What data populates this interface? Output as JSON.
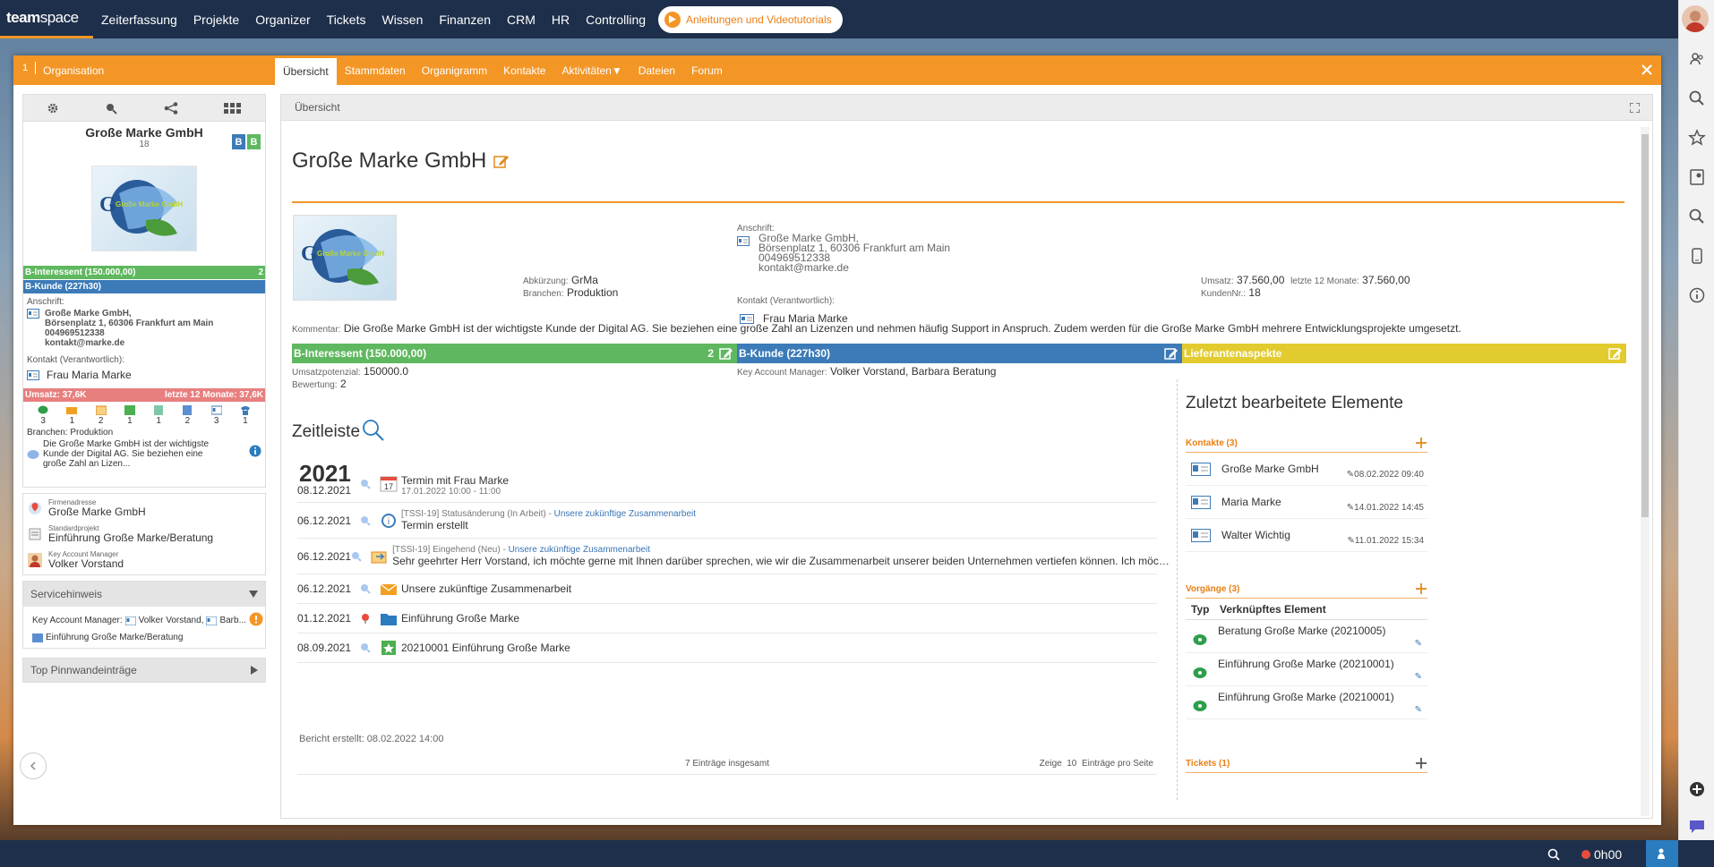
{
  "topnav": {
    "logo_bold": "team",
    "logo_light": "space",
    "items": [
      "Zeiterfassung",
      "Projekte",
      "Organizer",
      "Tickets",
      "Wissen",
      "Finanzen",
      "CRM",
      "HR",
      "Controlling"
    ],
    "tutorial_label": "Anleitungen und Videotutorials"
  },
  "window": {
    "number": "1",
    "title": "Organisation",
    "tabs": [
      "Übersicht",
      "Stammdaten",
      "Organigramm",
      "Kontakte",
      "Aktivitäten▼",
      "Dateien",
      "Forum"
    ]
  },
  "left": {
    "name": "Große Marke GmbH",
    "number": "18",
    "badges": [
      "B",
      "B"
    ],
    "logo_text": "Große Marke GmbH",
    "bar_green": "B-Interessent (150.000,00)",
    "bar_green_count": "2",
    "bar_blue": "B-Kunde (227h30)",
    "addr_label": "Anschrift:",
    "addr_lines": [
      "Große Marke GmbH,",
      "Börsenplatz 1, 60306 Frankfurt am Main",
      "004969512338",
      "kontakt@marke.de"
    ],
    "contact_label": "Kontakt (Verantwortlich):",
    "contact_name": "Frau Maria Marke",
    "umsatz_left": "Umsatz: 37,6K",
    "umsatz_right": "letzte 12 Monate: 37,6K",
    "counts": [
      "3",
      "1",
      "2",
      "1",
      "1",
      "2",
      "3",
      "1"
    ],
    "branchen": "Branchen: Produktion",
    "comment": "Die Große Marke GmbH ist der wichtigste Kunde der Digital AG. Sie beziehen eine große Zahl an Lizen...",
    "firmenadresse_label": "Firmenadresse",
    "firmenadresse": "Große Marke GmbH",
    "standardprojekt_label": "Standardprojekt",
    "standardprojekt": "Einführung Große Marke/Beratung",
    "kam_label": "Key Account Manager",
    "kam": "Volker Vorstand",
    "servicehinweis": "Servicehinweis",
    "service_kam_label": "Key Account Manager:",
    "service_kam_1": "Volker Vorstand,",
    "service_kam_2": "Barb...",
    "service_project": "Einführung Große Marke/Beratung",
    "pinnwand": "Top Pinnwandeinträge"
  },
  "main": {
    "header": "Übersicht",
    "title": "Große Marke GmbH",
    "abk_label": "Abkürzung:",
    "abk": "GrMa",
    "branchen_label": "Branchen:",
    "branchen": "Produktion",
    "anschrift_label": "Anschrift:",
    "addr_lines": [
      "Große Marke GmbH,",
      "Börsenplatz 1, 60306 Frankfurt am Main",
      "004969512338",
      "kontakt@marke.de"
    ],
    "kontakt_label": "Kontakt (Verantwortlich):",
    "kontakt": "Frau Maria Marke",
    "umsatz_label": "Umsatz:",
    "umsatz": "37.560,00",
    "l12_label": "letzte 12 Monate:",
    "l12": "37.560,00",
    "kundennr_label": "KundenNr.:",
    "kundennr": "18",
    "kommentar_label": "Kommentar:",
    "kommentar": "Die Große Marke GmbH ist der wichtigste Kunde der Digital AG. Sie beziehen eine große Zahl an Lizenzen und nehmen häufig Support in Anspruch. Zudem werden für die Große Marke GmbH mehrere Entwicklungsprojekte umgesetzt.",
    "tb_green": "B-Interessent (150.000,00)",
    "tb_green_count": "2",
    "tb_blue": "B-Kunde (227h30)",
    "tb_yellow": "Lieferantenaspekte",
    "potenzial_label": "Umsatzpotenzial:",
    "potenzial": "150000.0",
    "bewertung_label": "Bewertung:",
    "bewertung": "2",
    "kam_label": "Key Account Manager:",
    "kam": "Volker Vorstand, Barbara Beratung",
    "zeitleiste": "Zeitleiste",
    "year": "2021",
    "timeline": [
      {
        "date": "08.12.2021",
        "meta": "",
        "link": "",
        "text": "Termin mit Frau Marke",
        "sub": "17.01.2022 10:00 - 11:00"
      },
      {
        "date": "06.12.2021",
        "meta": "[TSSI-19] Statusänderung (In Arbeit) - ",
        "link": "Unsere zukünftige Zusammenarbeit",
        "text": "Termin erstellt",
        "sub": ""
      },
      {
        "date": "06.12.2021",
        "meta": "[TSSI-19] Eingehend (Neu) - ",
        "link": "Unsere zukünftige Zusammenarbeit",
        "text": "Sehr geehrter Herr Vorstand, ich möchte gerne mit Ihnen darüber sprechen, wie wir die Zusammenarbeit unserer beiden Unternehmen vertiefen können. Ich möchte deshalb zu diesem Zweck einen Tele...",
        "sub": ""
      },
      {
        "date": "06.12.2021",
        "meta": "",
        "link": "",
        "text": "Unsere zukünftige Zusammenarbeit",
        "sub": ""
      },
      {
        "date": "01.12.2021",
        "meta": "",
        "link": "",
        "text": "Einführung Große Marke",
        "sub": ""
      },
      {
        "date": "08.09.2021",
        "meta": "",
        "link": "",
        "text": "20210001 Einführung Große Marke",
        "sub": ""
      }
    ],
    "bericht": "Bericht erstellt: 08.02.2022 14:00",
    "eintraege": "7 Einträge insgesamt",
    "zeige": "Zeige",
    "per_page": "10",
    "per_page_label": "Einträge pro Seite",
    "zuletzt": "Zuletzt bearbeitete Elemente",
    "kontakte_sec": "Kontakte (3)",
    "kontakte": [
      {
        "name": "Große Marke GmbH",
        "date": "08.02.2022 09:40"
      },
      {
        "name": "Maria Marke",
        "date": "14.01.2022 14:45"
      },
      {
        "name": "Walter Wichtig",
        "date": "11.01.2022 15:34"
      }
    ],
    "vorgaenge_sec": "Vorgänge (3)",
    "col_typ": "Typ",
    "col_el": "Verknüpftes Element",
    "vorgaenge": [
      "Beratung Große Marke (20210005)",
      "Einführung Große Marke (20210001)",
      "Einführung Große Marke (20210001)"
    ],
    "tickets_sec": "Tickets (1)"
  },
  "bottombar": {
    "timer": "0h00"
  }
}
